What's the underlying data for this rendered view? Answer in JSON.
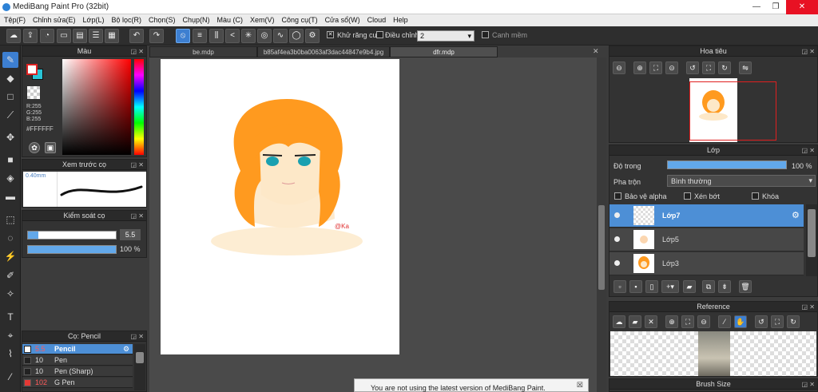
{
  "window": {
    "title": "MediBang Paint Pro (32bit)",
    "minimize": "—",
    "restore": "❐",
    "close": "✕"
  },
  "menu": [
    "Tệp(F)",
    "Chỉnh sửa(E)",
    "Lớp(L)",
    "Bộ lọc(R)",
    "Chọn(S)",
    "Chụp(N)",
    "Màu (C)",
    "Xem(V)",
    "Công cụ(T)",
    "Cửa sổ(W)",
    "Cloud",
    "Help"
  ],
  "toolbar": {
    "antialias_label": "Khử răng cưa",
    "adjust_label": "Điều chỉnh",
    "adjust_value": "2",
    "smooth_label": "Canh mềm"
  },
  "tabs": [
    "be.mdp",
    "b85af4ea3b0ba0063af3dac44847e9b4.jpg",
    "dfr.mdp"
  ],
  "color_panel": {
    "title": "Màu",
    "r": "R:255",
    "g": "G:255",
    "b": "B:255",
    "hex": "#FFFFFF"
  },
  "brush_preview": {
    "title": "Xem trước cọ",
    "size": "0.40mm"
  },
  "brush_control": {
    "title": "Kiểm soát cọ",
    "size_value": "5.5",
    "opacity_value": "100 %",
    "size_fraction": 0.12,
    "opacity_fraction": 1.0
  },
  "brush_list": {
    "title": "Cọ: Pencil",
    "items": [
      {
        "size": "5.5",
        "name": "Pencil",
        "color": "#ffffff"
      },
      {
        "size": "10",
        "name": "Pen",
        "color": "#222222"
      },
      {
        "size": "10",
        "name": "Pen (Sharp)",
        "color": "#222222"
      },
      {
        "size": "102",
        "name": "G Pen",
        "color": "#e53935"
      }
    ]
  },
  "navigator": {
    "title": "Hoa tiêu"
  },
  "layer_panel": {
    "title": "Lớp",
    "opacity_label": "Độ trong",
    "opacity_value": "100 %",
    "opacity_fraction": 1.0,
    "blend_label": "Pha trộn",
    "blend_value": "Bình thường",
    "protect_alpha": "Bảo vệ alpha",
    "clipping": "Xén bớt",
    "lock": "Khóa",
    "layers": [
      "Lớp7",
      "Lớp5",
      "Lớp3"
    ]
  },
  "reference": {
    "title": "Reference"
  },
  "brush_size": {
    "title": "Brush Size"
  },
  "notice": {
    "text": "You are not using the latest version of MediBang Paint."
  },
  "colors": {
    "accent": "#3d7fd1",
    "hair": "#ff9a1f",
    "skin": "#fde8c8"
  }
}
